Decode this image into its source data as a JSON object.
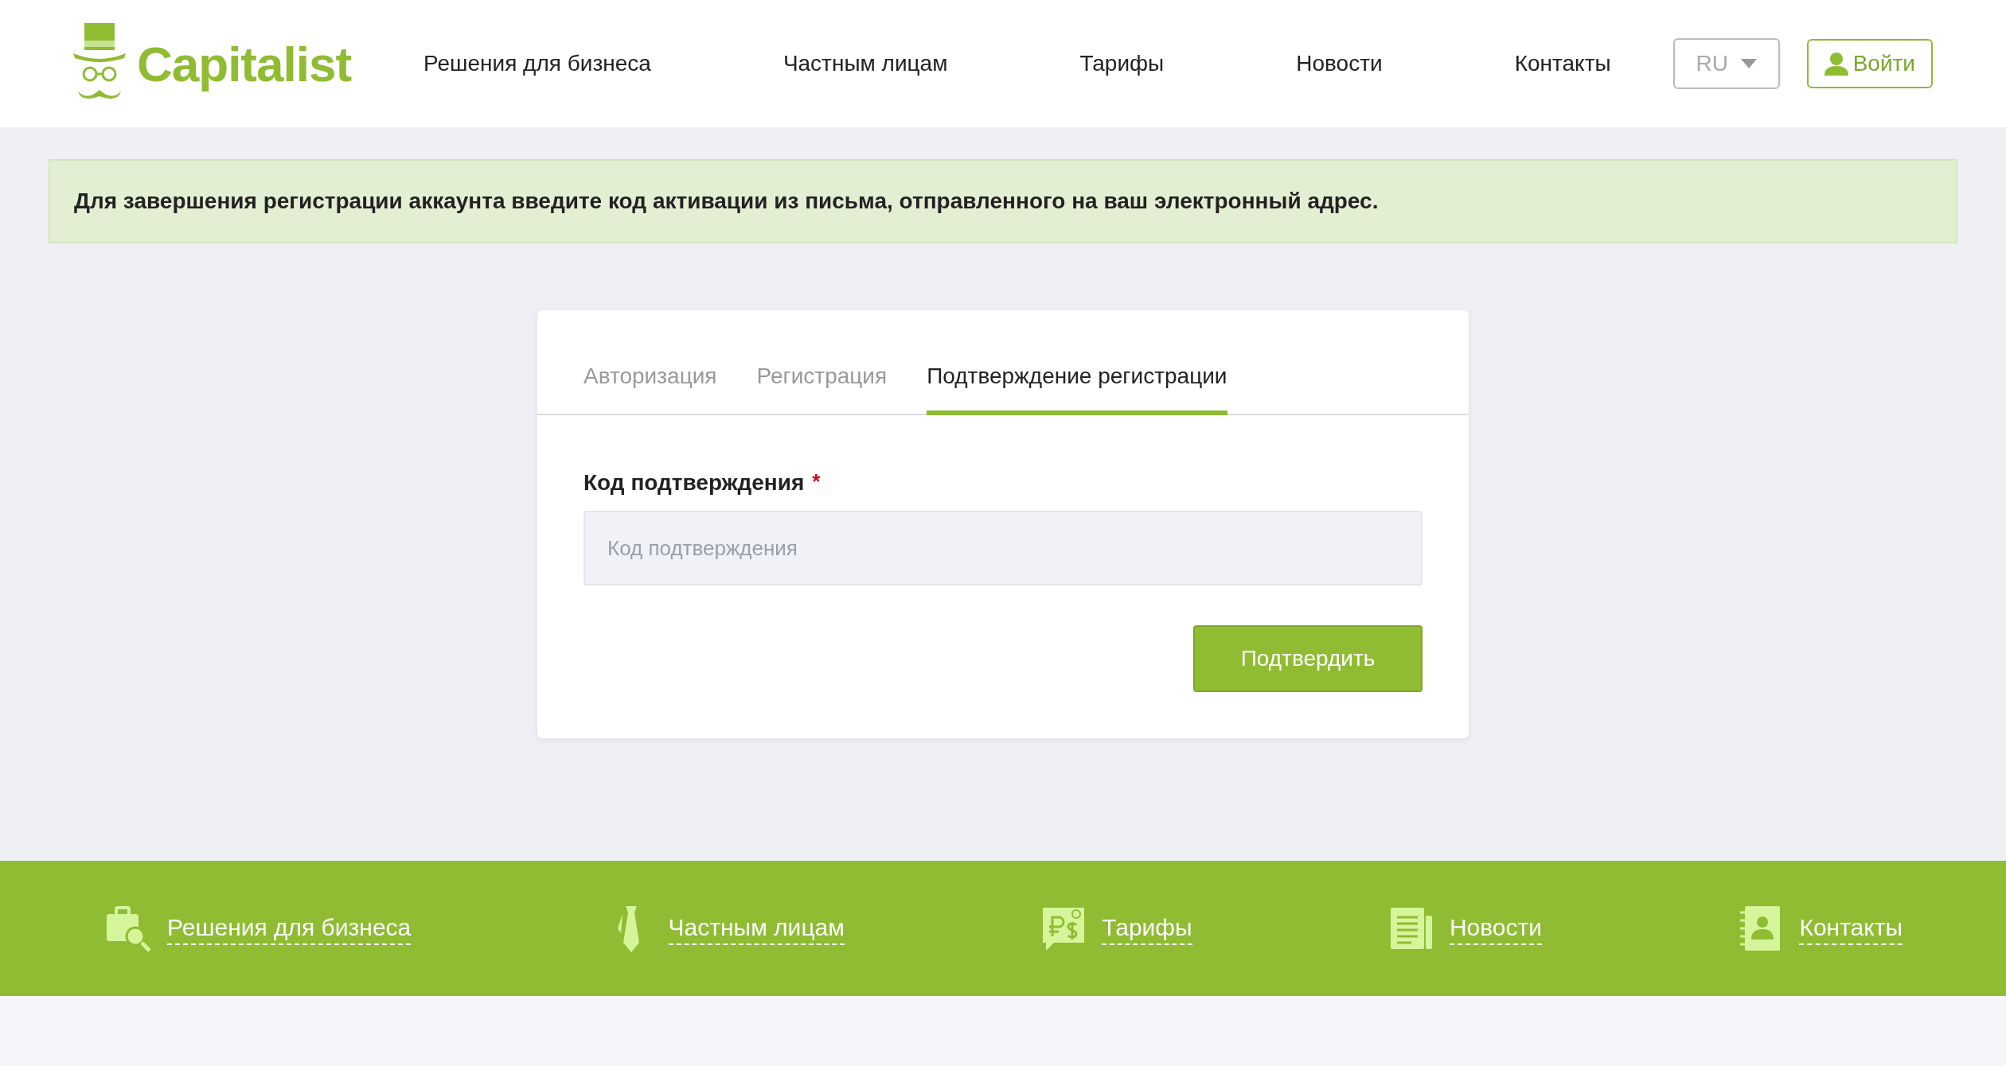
{
  "header": {
    "logo": "Capitalist",
    "nav": [
      "Решения для бизнеса",
      "Частным лицам",
      "Тарифы",
      "Новости",
      "Контакты"
    ],
    "language": "RU",
    "login": "Войти"
  },
  "alert": "Для завершения регистрации аккаунта введите код активации из письма, отправленного на ваш электронный адрес.",
  "tabs": [
    {
      "label": "Авторизация",
      "selected": false
    },
    {
      "label": "Регистрация",
      "selected": false
    },
    {
      "label": "Подтверждение регистрации",
      "selected": true
    }
  ],
  "form": {
    "label": "Код подтверждения",
    "required": true,
    "required_mark": "*",
    "placeholder": "Код подтверждения",
    "submit": "Подтвердить"
  },
  "footer_links": [
    "Решения для бизнеса",
    "Частным лицам",
    "Тарифы",
    "Новости",
    "Контакты"
  ]
}
